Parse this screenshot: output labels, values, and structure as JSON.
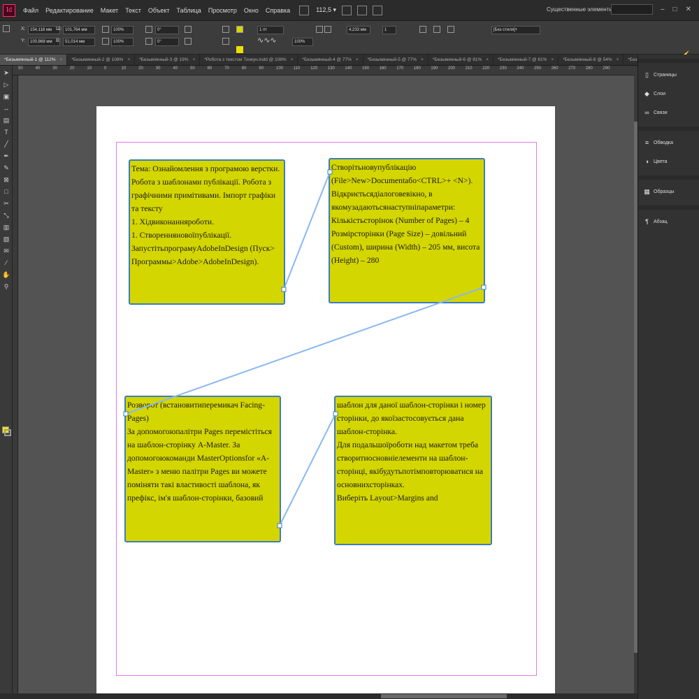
{
  "app": {
    "logo_text": "Id",
    "menu": [
      "Файл",
      "Редактирование",
      "Макет",
      "Текст",
      "Объект",
      "Таблица",
      "Просмотр",
      "Окно",
      "Справка"
    ],
    "zoom": "112,5",
    "workspace": "Существенные элементы",
    "accent_color": "#ff3366"
  },
  "control": {
    "x_label": "X:",
    "x_value": "154,118 мм",
    "y_label": "Y:",
    "y_value": "100,868 мм",
    "w_label": "Ш:",
    "w_value": "101,764 мм",
    "h_label": "В:",
    "h_value": "51,014 мм",
    "scale_x": "100%",
    "scale_y": "100%",
    "angle": "0°",
    "shear": "0°",
    "stroke_weight": "1 пт",
    "opacity": "100%",
    "gap": "4,233 мм",
    "columns": "1",
    "style": "[Без стиля]+",
    "stroke_color": "#f0e000"
  },
  "tabs": [
    {
      "label": "*Безымянный-1 @ 112%",
      "active": true
    },
    {
      "label": "*Безымянный-2 @ 108%"
    },
    {
      "label": "*Безымянный-3 @ 19%"
    },
    {
      "label": "*Робота з текстом Тонкун.indd @ 108%"
    },
    {
      "label": "*Безымянный-4 @ 77%"
    },
    {
      "label": "*Безымянный-5 @ 77%"
    },
    {
      "label": "*Безымянный-6 @ 81%"
    },
    {
      "label": "*Безымянный-7 @ 81%"
    },
    {
      "label": "*Безымянный-8 @ 54%"
    },
    {
      "label": "*Безымянный-9 @ 7"
    }
  ],
  "ruler_ticks": [
    "50",
    "40",
    "30",
    "20",
    "10",
    "0",
    "10",
    "20",
    "30",
    "40",
    "50",
    "60",
    "70",
    "80",
    "90",
    "100",
    "110",
    "120",
    "130",
    "140",
    "150",
    "160",
    "170",
    "180",
    "190",
    "200",
    "210",
    "220",
    "230",
    "240",
    "250",
    "260",
    "270",
    "280",
    "290"
  ],
  "frames": {
    "f1": "Тема: Ознайомлення з програмою верстки. Робота з шаблонами публікації. Робота з графічними примітивами. Імпорт графіки та тексту\n1. Хідвиконанняроботи.\n1. Створенняновоїпублікації.\nЗапустітьпрограмуAdobeInDesign (Пуск> Программы>Adobe>AdobeInDesign).",
    "f2": "Створітьновупублікацію (File>New>Documentабо<CTRL>+ <N>). Відкриєтьсядіалоговевікно, в якомузадаютьсянаступніпараметри:\nКількістьсторінок (Number of Pages) – 4\nРозмірсторінки (Page Size) – довільний (Custom), ширина (Width) – 205 мм, висота (Height) – 280",
    "f3": "Розворот (встановитиперемикач Facing-Pages)\nЗа допомогоюпалітри Pages перемістіться на шаблон-сторінку А-Master. За допомогоюкоманди MasterOptionsfor «А-Master» з меню палітри Pages ви можете поміняти такі властивості шаблона, як префікс, ім'я шаблон-сторінки, базовий",
    "f4": "шаблон для даної шаблон-сторінки і номер сторінки, до якоїзастосовується дана шаблон-сторінка.\nДля подальшоїроботи над макетом треба створитиосновніелементи на шаблон-сторінці, якібудутьпотімповторюватися на основнихсторінках.\nВиберіть Layout>Margins and"
  },
  "panels": {
    "group1": [
      {
        "icon": "pages-icon",
        "glyph": "▯",
        "label": "Страницы"
      },
      {
        "icon": "layers-icon",
        "glyph": "◆",
        "label": "Слои"
      },
      {
        "icon": "links-icon",
        "glyph": "∞",
        "label": "Связи"
      }
    ],
    "group2": [
      {
        "icon": "stroke-icon",
        "glyph": "≡",
        "label": "Обводка"
      },
      {
        "icon": "color-icon",
        "glyph": "◑",
        "label": "Цвета"
      }
    ],
    "group3": [
      {
        "icon": "swatches-icon",
        "glyph": "▦",
        "label": "Образцы"
      }
    ],
    "group4": [
      {
        "icon": "paragraph-icon",
        "glyph": "¶",
        "label": "Абзац"
      }
    ]
  },
  "page": {
    "frame_fill": "#d4d600",
    "thread_color": "#8ab8f0",
    "margin_color": "#e27ae6"
  }
}
